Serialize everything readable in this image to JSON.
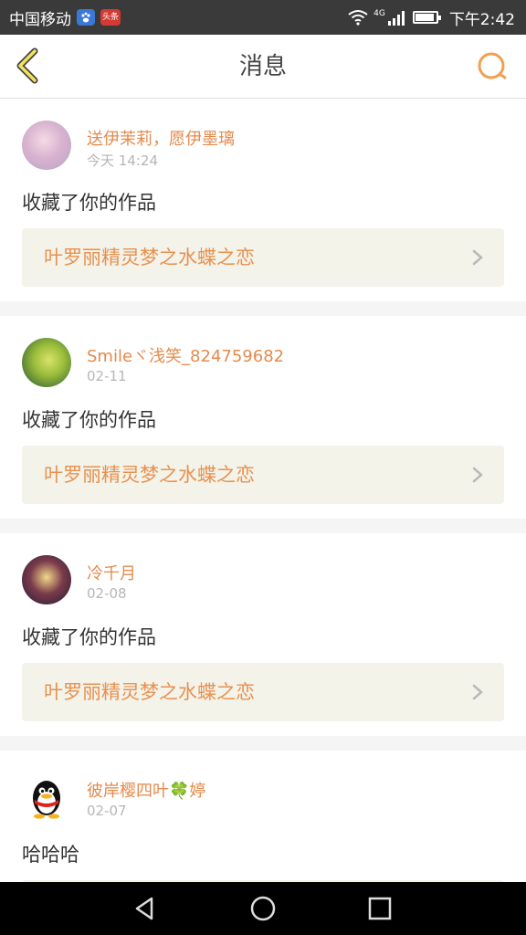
{
  "status_bar": {
    "carrier": "中国移动",
    "baidu_icon": "baidu-app-icon",
    "toutiao_label": "头条",
    "network": "4G",
    "time": "下午2:42"
  },
  "header": {
    "title": "消息",
    "back_icon": "chevron-left-icon",
    "search_icon": "search-icon",
    "accent_color": "#f0a050"
  },
  "messages": [
    {
      "username": "送伊茉莉，愿伊墨璃",
      "time": "今天 14:24",
      "text": "收藏了你的作品",
      "work_title": "叶罗丽精灵梦之水蝶之恋"
    },
    {
      "username": "Smileヾ浅笑_824759682",
      "time": "02-11",
      "text": "收藏了你的作品",
      "work_title": "叶罗丽精灵梦之水蝶之恋"
    },
    {
      "username": "冷千月",
      "time": "02-08",
      "text": "收藏了你的作品",
      "work_title": "叶罗丽精灵梦之水蝶之恋"
    },
    {
      "username": "彼岸樱四叶🍀婷",
      "time": "02-07",
      "text": "哈哈哈",
      "work_title": ""
    }
  ],
  "colors": {
    "username": "#e58a4c",
    "work_title": "#e8914f",
    "work_bg": "#f3f3ea"
  }
}
